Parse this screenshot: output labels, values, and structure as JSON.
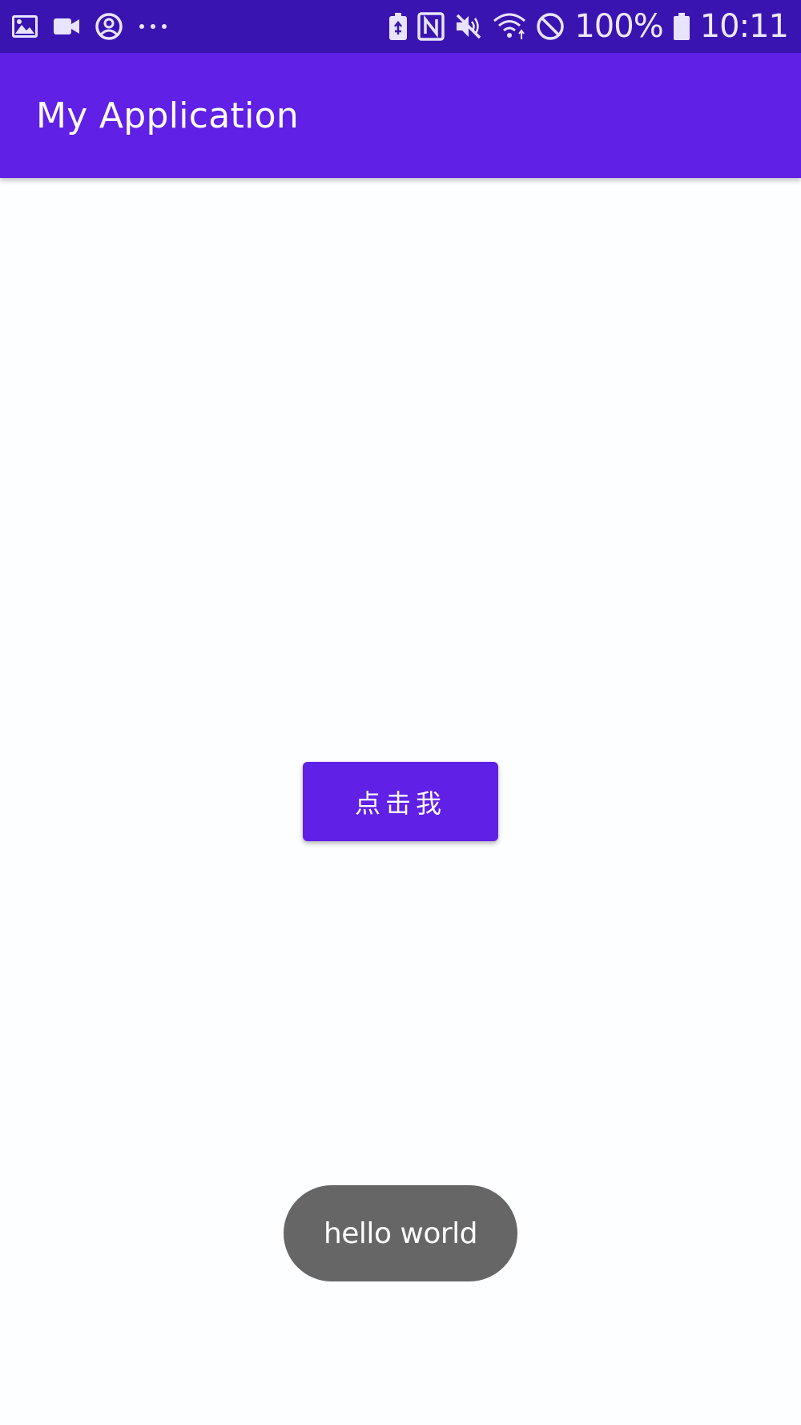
{
  "status_bar": {
    "left_icons": [
      "gallery-icon",
      "video-camera-icon",
      "account-circle-icon",
      "more-dots-icon"
    ],
    "right_icons": [
      "battery-saver-icon",
      "nfc-icon",
      "mute-icon",
      "wifi-icon",
      "do-not-disturb-icon",
      "battery-icon"
    ],
    "battery": "100%",
    "time": "10:11"
  },
  "app_bar": {
    "title": "My Application"
  },
  "main": {
    "button_label": "点击我"
  },
  "toast": {
    "message": "hello world"
  },
  "colors": {
    "status_bar": "#3a14b0",
    "primary": "#6020e6",
    "background": "#fdfeff",
    "toast": "#666667"
  }
}
